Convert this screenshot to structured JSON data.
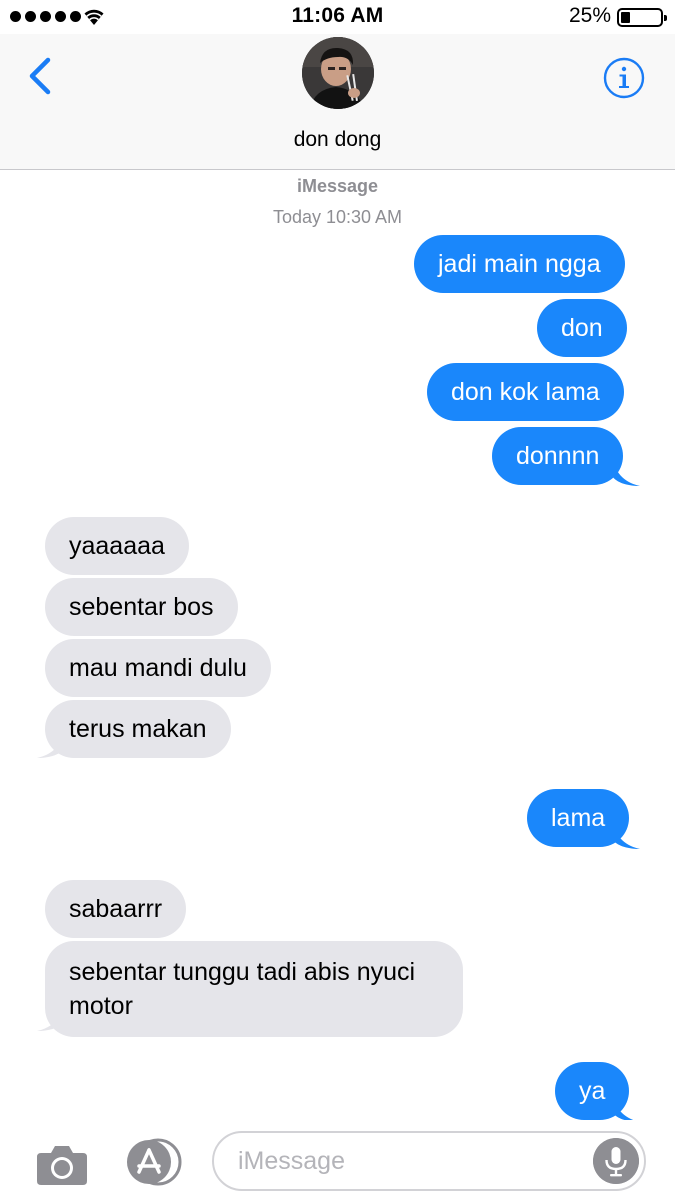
{
  "status_bar": {
    "time": "11:06 AM",
    "battery_percent": "25%",
    "battery_level": 0.25,
    "signal_bars": 5
  },
  "header": {
    "contact_name": "don dong",
    "back_icon": "chevron-left-icon",
    "info_icon": "info-icon"
  },
  "conversation": {
    "service": "iMessage",
    "timestamp": "Today 10:30 AM",
    "messages": [
      {
        "direction": "sent",
        "text": "jadi main ngga"
      },
      {
        "direction": "sent",
        "text": "don"
      },
      {
        "direction": "sent",
        "text": "don kok lama"
      },
      {
        "direction": "sent",
        "text": "donnnn"
      },
      {
        "direction": "received",
        "text": "yaaaaaa"
      },
      {
        "direction": "received",
        "text": "sebentar bos"
      },
      {
        "direction": "received",
        "text": "mau mandi dulu"
      },
      {
        "direction": "received",
        "text": "terus makan"
      },
      {
        "direction": "sent",
        "text": "lama"
      },
      {
        "direction": "received",
        "text": "sabaarrr"
      },
      {
        "direction": "received",
        "text": "sebentar tunggu tadi abis nyuci motor"
      },
      {
        "direction": "sent",
        "text": "ya"
      }
    ]
  },
  "input_bar": {
    "placeholder": "iMessage",
    "camera_icon": "camera-icon",
    "apps_icon": "app-store-icon",
    "mic_icon": "microphone-icon"
  },
  "colors": {
    "sent_bubble": "#1a87fb",
    "received_bubble": "#e5e5ea",
    "accent": "#1a7cf5",
    "meta_text": "#8e8e93"
  }
}
